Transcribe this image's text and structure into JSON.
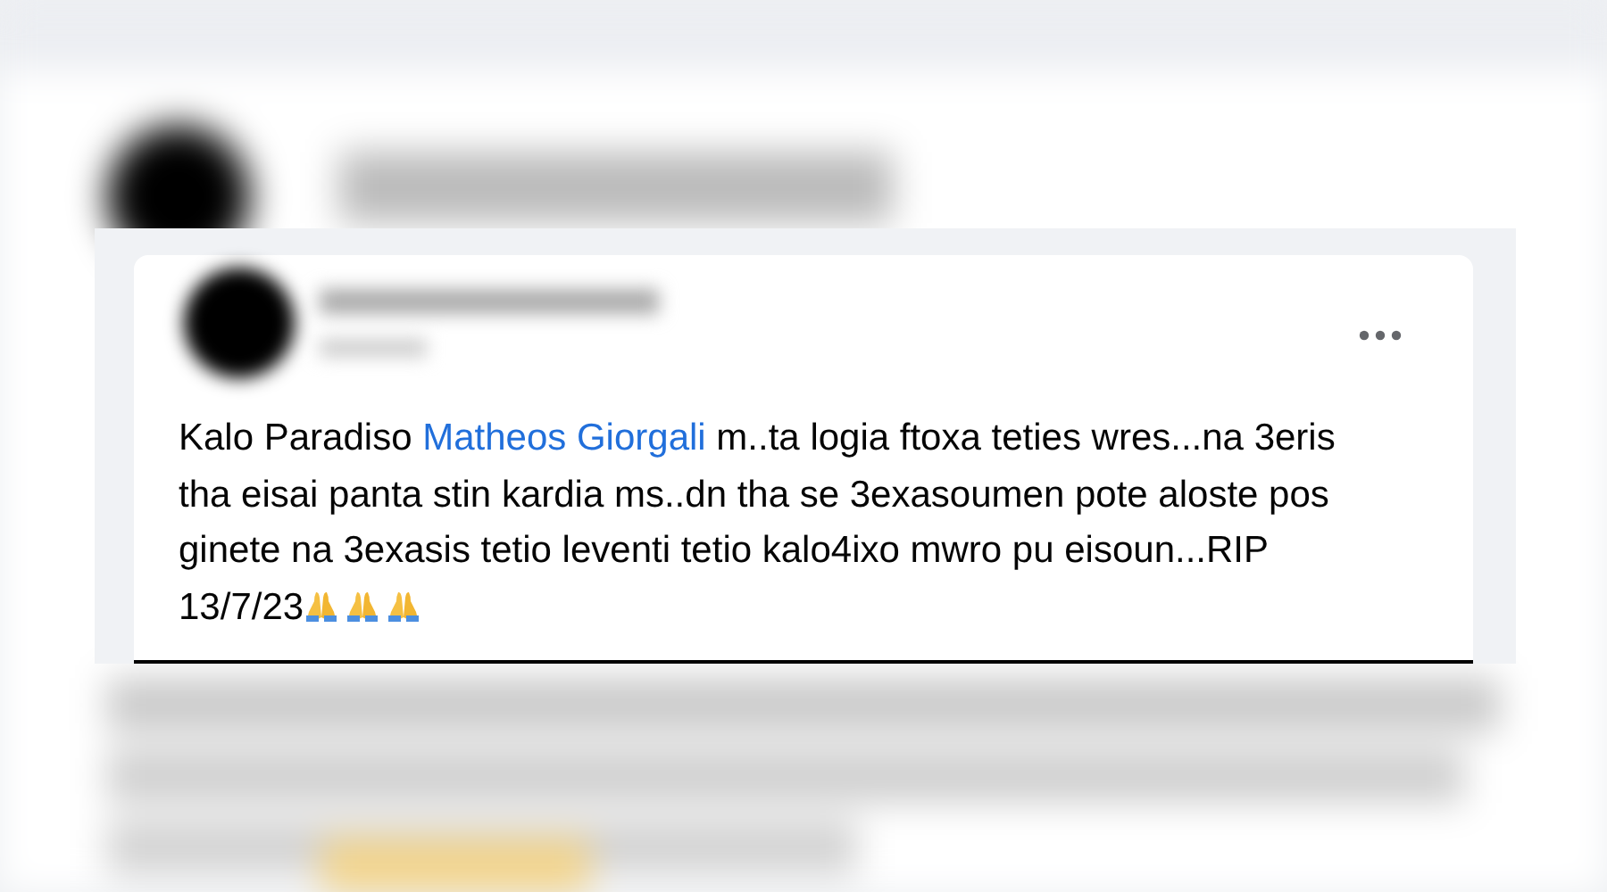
{
  "post": {
    "message": [
      {
        "kind": "text",
        "text": "Kalo Paradiso "
      },
      {
        "kind": "mention",
        "text": "Matheos Giorgali"
      },
      {
        "kind": "text",
        "text": " m..ta logia ftoxa teties wres...na 3eris tha eisai panta stin kardia ms..dn tha se 3exasoumen pote aloste pos ginete na 3exasis tetio leventi tetio kalo4ixo mwro pu eisoun...RIP 13/7/23"
      },
      {
        "kind": "praying_hands"
      },
      {
        "kind": "praying_hands"
      },
      {
        "kind": "praying_hands"
      }
    ]
  }
}
